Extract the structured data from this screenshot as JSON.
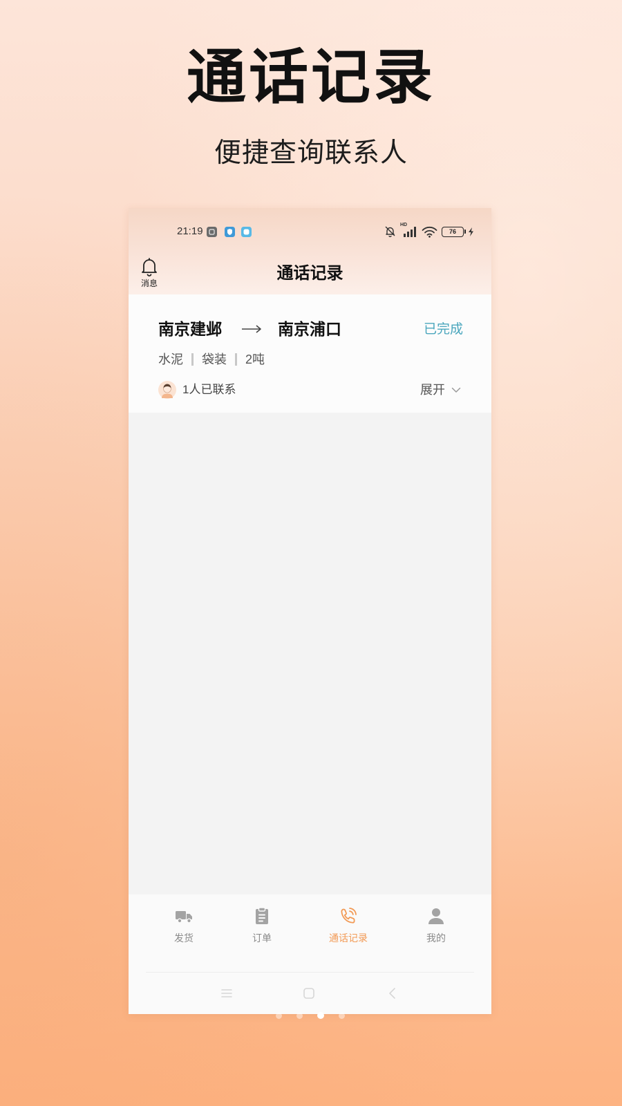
{
  "promo": {
    "title": "通话记录",
    "subtitle": "便捷查询联系人"
  },
  "status_bar": {
    "time": "21:19",
    "network_label": "HD",
    "battery_level": "76",
    "notification_icons": [
      "notification-app-icon",
      "notification-shield-icon",
      "notification-chat-icon"
    ],
    "indicator_icons": [
      "bell-off-icon",
      "signal-icon",
      "wifi-icon",
      "battery-icon",
      "charging-bolt-icon"
    ]
  },
  "header": {
    "title": "通话记录",
    "message_label": "消息",
    "message_icon": "bell-icon"
  },
  "record": {
    "origin": "南京建邺",
    "route_icon": "arrow-right-icon",
    "destination": "南京浦口",
    "status": "已完成",
    "tags": [
      "水泥",
      "袋装",
      "2吨"
    ],
    "contacted": "1人已联系",
    "expand_label": "展开",
    "expand_icon": "chevron-down-icon"
  },
  "bottom_nav": {
    "items": [
      {
        "label": "发货",
        "icon": "truck-icon",
        "active": false
      },
      {
        "label": "订单",
        "icon": "clipboard-icon",
        "active": false
      },
      {
        "label": "通话记录",
        "icon": "phone-call-icon",
        "active": true
      },
      {
        "label": "我的",
        "icon": "person-icon",
        "active": false
      }
    ]
  },
  "system_nav": {
    "icons": [
      "menu-icon",
      "home-icon",
      "back-icon"
    ]
  },
  "pager": {
    "page_count": 4,
    "active_page": 3
  },
  "colors": {
    "accent": "#f29a55",
    "status": "#4aa6bd",
    "background_top": "#fde5d9",
    "background_bottom": "#fdb382"
  }
}
